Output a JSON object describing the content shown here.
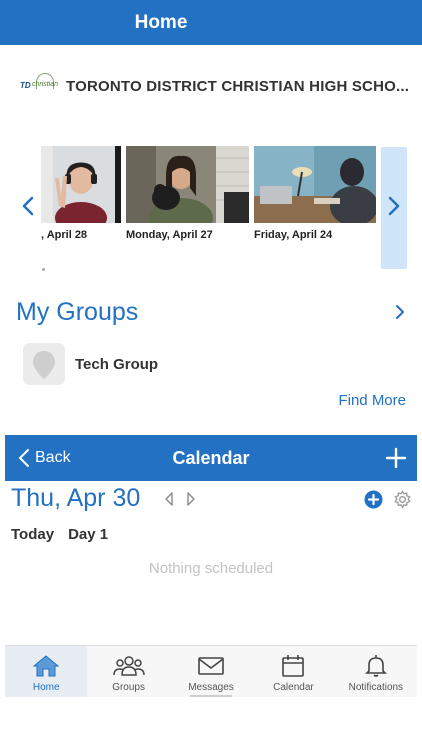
{
  "header": {
    "title": "Home"
  },
  "school": {
    "logo_text_td": "TD",
    "logo_text_christian": "christian",
    "name": "TORONTO DISTRICT CHRISTIAN HIGH SCHO..."
  },
  "carousel": {
    "cards": [
      {
        "date": ", April 28"
      },
      {
        "date": "Monday, April 27"
      },
      {
        "date": "Friday, April 24"
      }
    ]
  },
  "groups": {
    "title": "My Groups",
    "items": [
      {
        "name": "Tech Group"
      }
    ],
    "find_more": "Find More"
  },
  "calendar": {
    "back_label": "Back",
    "title": "Calendar",
    "date": "Thu, Apr 30",
    "today_label": "Today",
    "day_label": "Day 1",
    "empty_text": "Nothing scheduled"
  },
  "tabs": [
    {
      "label": "Home",
      "icon": "home-icon",
      "active": true
    },
    {
      "label": "Groups",
      "icon": "groups-icon",
      "active": false
    },
    {
      "label": "Messages",
      "icon": "messages-icon",
      "active": false
    },
    {
      "label": "Calendar",
      "icon": "calendar-icon",
      "active": false
    },
    {
      "label": "Notifications",
      "icon": "bell-icon",
      "active": false
    }
  ],
  "colors": {
    "brand": "#2271c3",
    "carousel_panel": "#cfe6fa",
    "muted": "#c3c3c3"
  }
}
